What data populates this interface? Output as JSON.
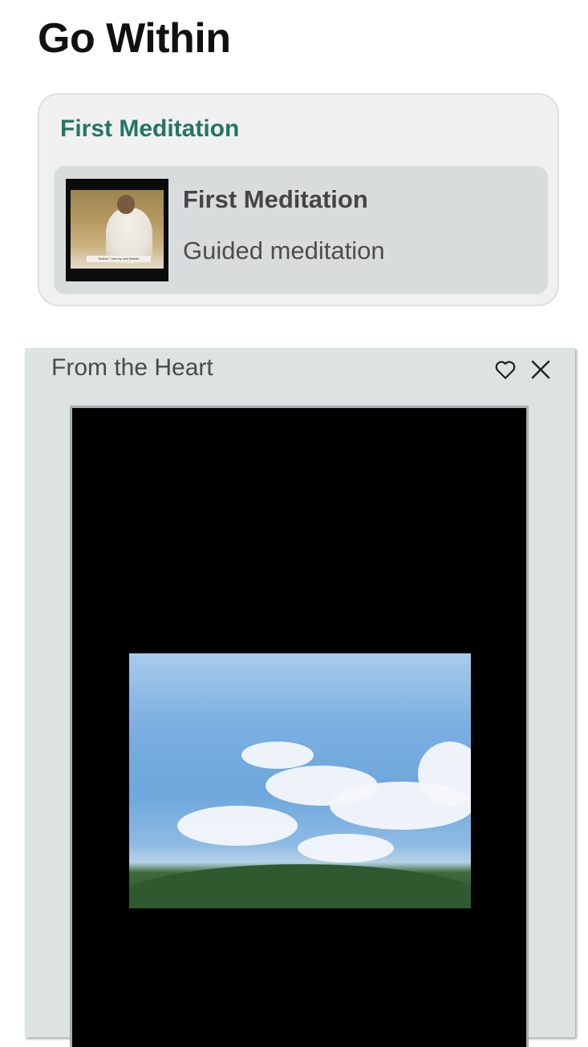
{
  "page": {
    "title": "Go Within"
  },
  "section": {
    "title": "First Meditation",
    "items": [
      {
        "title": "First Meditation",
        "subtitle": "Guided meditation",
        "thumbnail_caption": "Mother: I am my own Master"
      }
    ]
  },
  "player": {
    "title": "From the Heart",
    "icons": {
      "favorite": "heart-outline-icon",
      "close": "close-icon"
    }
  },
  "colors": {
    "accent": "#247563",
    "card_bg": "#f0f0f0",
    "item_bg": "#d9dcdd",
    "player_bg": "#dde2e3"
  }
}
